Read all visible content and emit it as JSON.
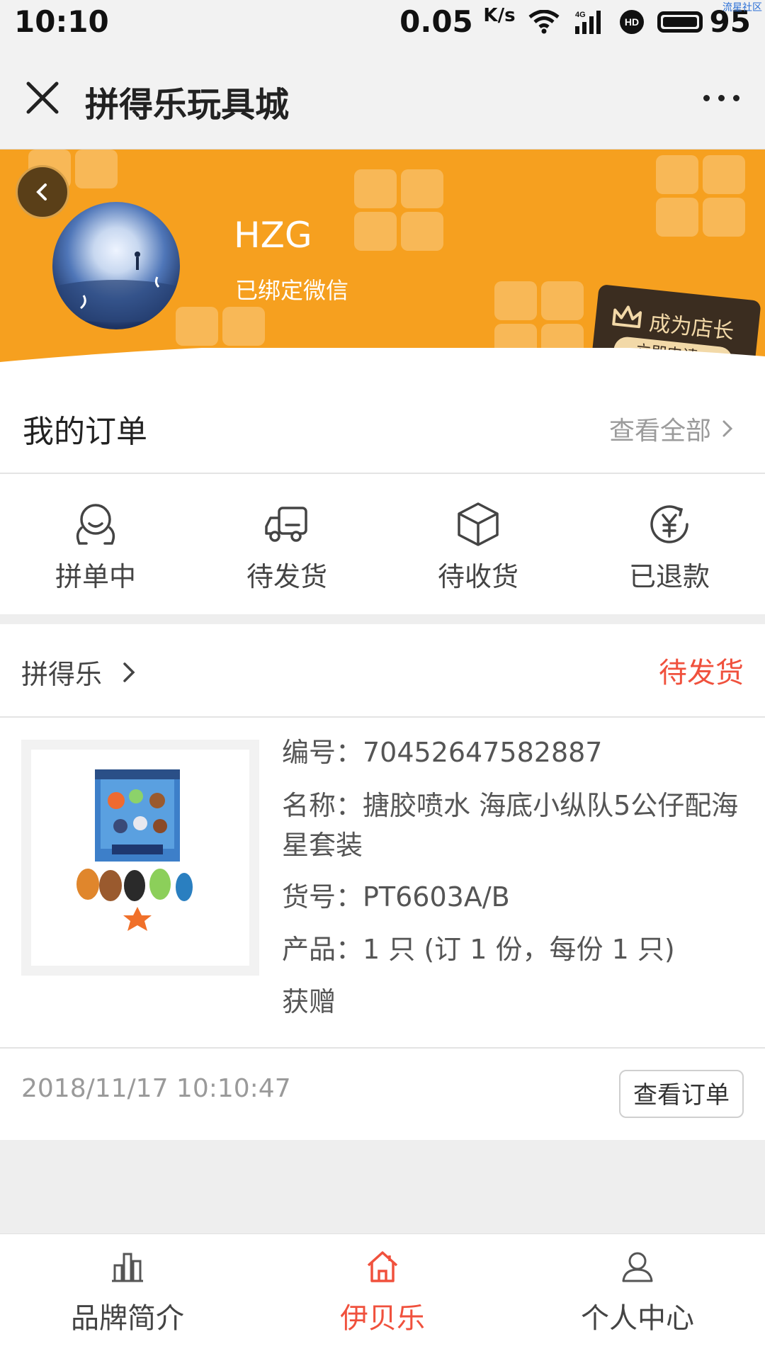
{
  "status_bar": {
    "time": "10:10",
    "net_speed": "0.05",
    "net_unit": "K/s",
    "signal_type": "4G",
    "battery_level": "95",
    "watermark": "流星社区"
  },
  "title_bar": {
    "title": "拼得乐玩具城"
  },
  "profile": {
    "name": "HZG",
    "bind_status": "已绑定微信",
    "shopkeeper_title": "成为店长",
    "shopkeeper_apply": "立即申请>"
  },
  "orders": {
    "title": "我的订单",
    "view_all": "查看全部",
    "statuses": [
      {
        "label": "拼单中",
        "icon": "group-buy-icon"
      },
      {
        "label": "待发货",
        "icon": "truck-icon"
      },
      {
        "label": "待收货",
        "icon": "package-icon"
      },
      {
        "label": "已退款",
        "icon": "refund-icon"
      }
    ]
  },
  "order_card": {
    "store": "拼得乐",
    "status": "待发货",
    "number": "编号：70452647582887",
    "name": "名称：搪胶喷水 海底小纵队5公仔配海星套装",
    "sku": "货号：PT6603A/B",
    "product": "产品：1 只 (订 1 份，每份 1 只)",
    "gift": "获赠",
    "time": "2018/11/17 10:10:47",
    "view_order": "查看订单"
  },
  "bottom_nav": {
    "items": [
      {
        "label": "品牌简介",
        "icon": "chart-icon",
        "active": false
      },
      {
        "label": "伊贝乐",
        "icon": "home-icon",
        "active": true
      },
      {
        "label": "个人中心",
        "icon": "user-icon",
        "active": false
      }
    ]
  },
  "colors": {
    "accent": "#f0513d",
    "banner": "#f6a01f"
  }
}
